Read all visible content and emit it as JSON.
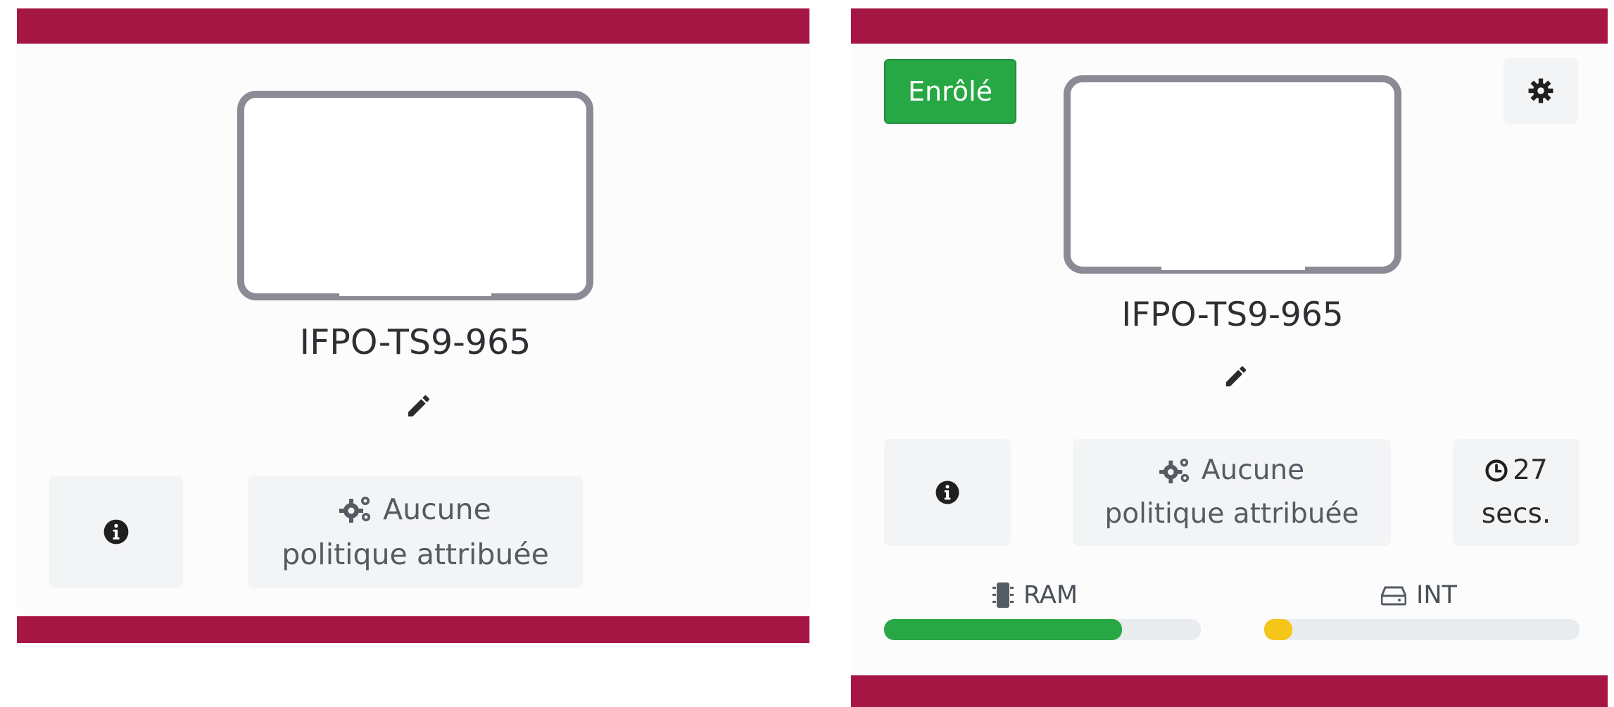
{
  "colors": {
    "brand_bar": "#a61644",
    "enrolled_green": "#28a745",
    "ram_fill": "#28a745",
    "storage_fill": "#f5c518",
    "device_frame": "#8b8b95"
  },
  "cards": [
    {
      "device_name": "IFPO-TS9-965",
      "info_icon": "info-circle-icon",
      "edit_icon": "pencil-icon",
      "policy": {
        "icon": "cogs-icon",
        "line1": "Aucune",
        "line2": "politique attribuée"
      }
    },
    {
      "status_badge": "Enrôlé",
      "settings_icon": "gear-icon",
      "device_name": "IFPO-TS9-965",
      "info_icon": "info-circle-icon",
      "edit_icon": "pencil-icon",
      "policy": {
        "icon": "cogs-icon",
        "line1": "Aucune",
        "line2": "politique attribuée"
      },
      "last_seen": {
        "icon": "clock-icon",
        "value": "27",
        "unit": "secs."
      },
      "ram": {
        "icon": "memory-chip-icon",
        "label": "RAM",
        "percent": 75
      },
      "storage": {
        "icon": "hdd-icon",
        "label": "INT",
        "percent": 9
      }
    }
  ]
}
